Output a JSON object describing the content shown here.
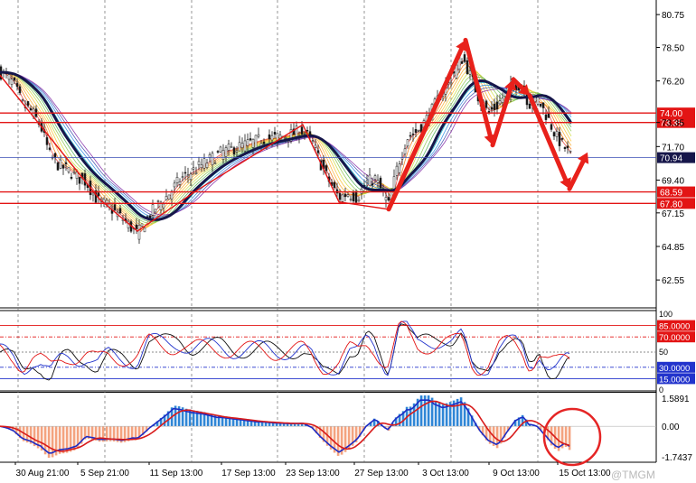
{
  "chart_data": [
    {
      "type": "candlestick",
      "title": "",
      "price_axis_ticks": [
        "80.75",
        "78.50",
        "76.20",
        "73.35",
        "71.70",
        "69.40",
        "67.15",
        "64.85",
        "62.55"
      ],
      "ylim": [
        60.7,
        81.75
      ],
      "x_tick_labels": [
        "30 Aug 21:00",
        "5 Sep 21:00",
        "11 Sep 13:00",
        "17 Sep 13:00",
        "23 Sep 13:00",
        "27 Sep 13:00",
        "3 Oct 13:00",
        "9 Oct 13:00",
        "15 Oct 13:00"
      ],
      "current_price": "70.94",
      "support_resistance_levels": [
        {
          "label": "74.00",
          "value": 74.0
        },
        {
          "label": "73.35",
          "value": 73.35
        },
        {
          "label": "68.59",
          "value": 68.59
        },
        {
          "label": "67.80",
          "value": 67.8
        }
      ],
      "price_path": [
        [
          0,
          76.8
        ],
        [
          8,
          76.5
        ],
        [
          15,
          76.0
        ],
        [
          25,
          74.6
        ],
        [
          35,
          74.1
        ],
        [
          45,
          73.1
        ],
        [
          55,
          71.1
        ],
        [
          65,
          70.4
        ],
        [
          75,
          70.1
        ],
        [
          85,
          69.6
        ],
        [
          95,
          69.3
        ],
        [
          108,
          68.0
        ],
        [
          120,
          67.6
        ],
        [
          135,
          66.8
        ],
        [
          152,
          65.7
        ],
        [
          165,
          67.0
        ],
        [
          175,
          67.7
        ],
        [
          185,
          68.3
        ],
        [
          200,
          69.5
        ],
        [
          215,
          70.1
        ],
        [
          230,
          70.7
        ],
        [
          245,
          71.3
        ],
        [
          260,
          71.6
        ],
        [
          275,
          71.9
        ],
        [
          290,
          72.2
        ],
        [
          305,
          72.3
        ],
        [
          320,
          72.5
        ],
        [
          335,
          72.8
        ],
        [
          345,
          72.1
        ],
        [
          355,
          70.5
        ],
        [
          365,
          69.2
        ],
        [
          375,
          68.2
        ],
        [
          385,
          68.5
        ],
        [
          395,
          68.2
        ],
        [
          405,
          69.2
        ],
        [
          415,
          69.5
        ],
        [
          425,
          68.3
        ],
        [
          430,
          67.7
        ],
        [
          440,
          70.4
        ],
        [
          450,
          72.3
        ],
        [
          460,
          72.7
        ],
        [
          470,
          73.4
        ],
        [
          480,
          74.4
        ],
        [
          490,
          75.6
        ],
        [
          500,
          76.5
        ],
        [
          510,
          77.8
        ],
        [
          515,
          77.4
        ],
        [
          520,
          76.6
        ],
        [
          530,
          75.0
        ],
        [
          540,
          74.0
        ],
        [
          550,
          74.5
        ],
        [
          560,
          75.4
        ],
        [
          570,
          76.0
        ],
        [
          578,
          75.9
        ],
        [
          585,
          74.6
        ],
        [
          595,
          74.9
        ],
        [
          605,
          73.8
        ],
        [
          615,
          72.4
        ],
        [
          625,
          71.6
        ],
        [
          632,
          71.0
        ]
      ],
      "drawn_pattern": [
        [
          0,
          76.6
        ],
        [
          110,
          68.1
        ],
        [
          152,
          65.9
        ],
        [
          218,
          68.7
        ],
        [
          335,
          73.2
        ],
        [
          375,
          67.9
        ],
        [
          430,
          67.4
        ],
        [
          515,
          79.0
        ],
        [
          545,
          71.8
        ],
        [
          568,
          76.3
        ],
        [
          586,
          75.2
        ],
        [
          630,
          68.8
        ],
        [
          650,
          71.3
        ]
      ]
    },
    {
      "type": "line",
      "title": "",
      "indicator_ticks": [
        "100",
        "85.0000",
        "70.0000",
        "50",
        "30.0000",
        "15.0000",
        "0"
      ],
      "levels": [
        85,
        70,
        50,
        30,
        15
      ],
      "ylim": [
        0,
        100
      ]
    },
    {
      "type": "bar",
      "title": "",
      "indicator_ticks": [
        "1.5891",
        "0.00",
        "-1.7437"
      ],
      "ylim": [
        -1.7437,
        1.5891
      ]
    }
  ],
  "watermark": "@TMGM"
}
